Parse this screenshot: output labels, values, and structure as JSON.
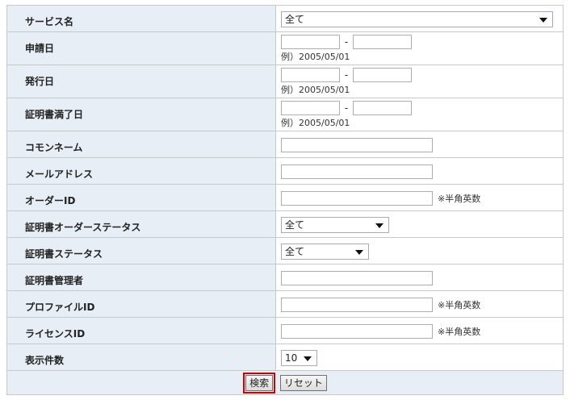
{
  "form": {
    "service_name": {
      "label": "サービス名",
      "selected": "全て"
    },
    "apply_date": {
      "label": "申請日",
      "dash": "-",
      "example": "例）2005/05/01"
    },
    "issue_date": {
      "label": "発行日",
      "dash": "-",
      "example": "例）2005/05/01"
    },
    "expire_date": {
      "label": "証明書満了日",
      "dash": "-",
      "example": "例）2005/05/01"
    },
    "common_name": {
      "label": "コモンネーム",
      "value": ""
    },
    "email": {
      "label": "メールアドレス",
      "value": ""
    },
    "order_id": {
      "label": "オーダーID",
      "value": "",
      "note": "※半角英数"
    },
    "cert_order_status": {
      "label": "証明書オーダーステータス",
      "selected": "全て"
    },
    "cert_status": {
      "label": "証明書ステータス",
      "selected": "全て"
    },
    "cert_admin": {
      "label": "証明書管理者",
      "value": ""
    },
    "profile_id": {
      "label": "プロファイルID",
      "value": "",
      "note": "※半角英数"
    },
    "license_id": {
      "label": "ライセンスID",
      "value": "",
      "note": "※半角英数"
    },
    "display_count": {
      "label": "表示件数",
      "selected": "10"
    }
  },
  "buttons": {
    "search": "検索",
    "reset": "リセット"
  }
}
